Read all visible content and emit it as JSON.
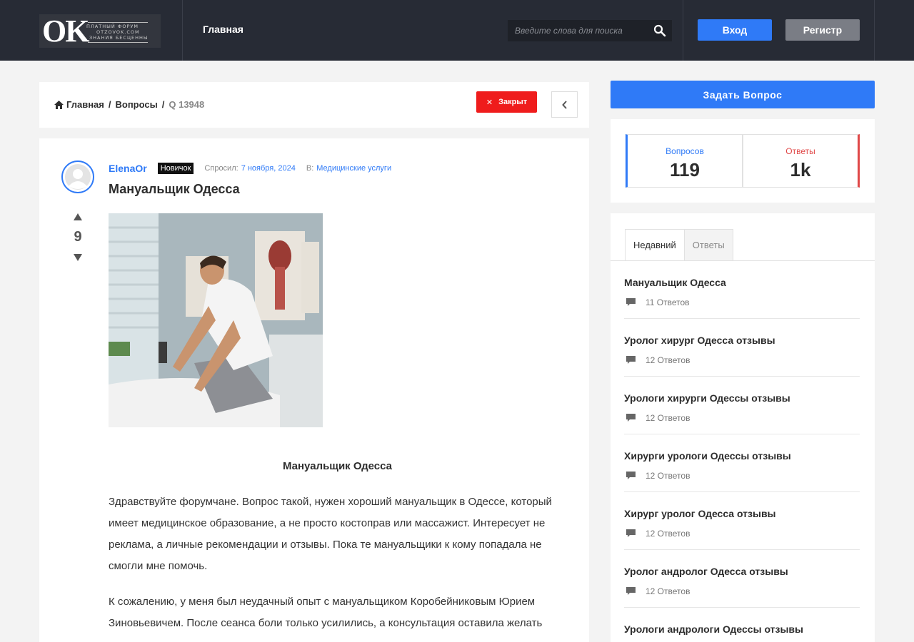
{
  "header": {
    "logo": {
      "main": "OK",
      "line1": "ПЛАТНЫЙ ФОРУМ",
      "line2": "OTZOVOK.COM",
      "line3": "ЗНАНИЯ БЕСЦЕННЫ"
    },
    "nav_home": "Главная",
    "search_placeholder": "Введите слова для поиска",
    "login_label": "Вход",
    "register_label": "Регистр"
  },
  "breadcrumb": {
    "home": "Главная",
    "section": "Вопросы",
    "current": "Q 13948",
    "closed_label": "Закрыт"
  },
  "question": {
    "author": "ElenaOr",
    "badge": "Новичок",
    "asked_label": "Спросил:",
    "asked_date": "7 ноября, 2024",
    "in_label": "В:",
    "category": "Медицинские услуги",
    "votes": "9",
    "title": "Мануальщик Одесса",
    "subtitle": "Мануальщик Одесса",
    "paragraphs": [
      "Здравствуйте форумчане. Вопрос такой, нужен хороший мануальщик в Одессе, который имеет медицинское образование, а не просто костоправ или массажист. Интересует не реклама, а личные рекомендации и отзывы. Пока те мануальщики к кому попадала не смогли мне помочь.",
      "К сожалению, у меня был неудачный опыт с мануальщиком Коробейниковым Юрием Зиновьевичем. После сеанса боли только усилились, а консультация оставила желать"
    ]
  },
  "sidebar": {
    "ask_button": "Задать Вопрос",
    "stats": {
      "questions_label": "Вопросов",
      "questions_value": "119",
      "answers_label": "Ответы",
      "answers_value": "1k"
    },
    "tabs": [
      "Недавний",
      "Ответы"
    ],
    "recent": [
      {
        "title": "Мануальщик Одесса",
        "answers": "11 Ответов"
      },
      {
        "title": "Уролог хирург Одесса отзывы",
        "answers": "12 Ответов"
      },
      {
        "title": "Урологи хирурги Одессы отзывы",
        "answers": "12 Ответов"
      },
      {
        "title": "Хирурги урологи Одессы отзывы",
        "answers": "12 Ответов"
      },
      {
        "title": "Хирург уролог Одесса отзывы",
        "answers": "12 Ответов"
      },
      {
        "title": "Уролог андролог Одесса отзывы",
        "answers": "12 Ответов"
      },
      {
        "title": "Урологи андрологи Одессы отзывы",
        "answers": ""
      }
    ]
  },
  "colors": {
    "accent": "#2f7af7",
    "danger": "#ef1c1c",
    "header_bg": "#272b35"
  }
}
